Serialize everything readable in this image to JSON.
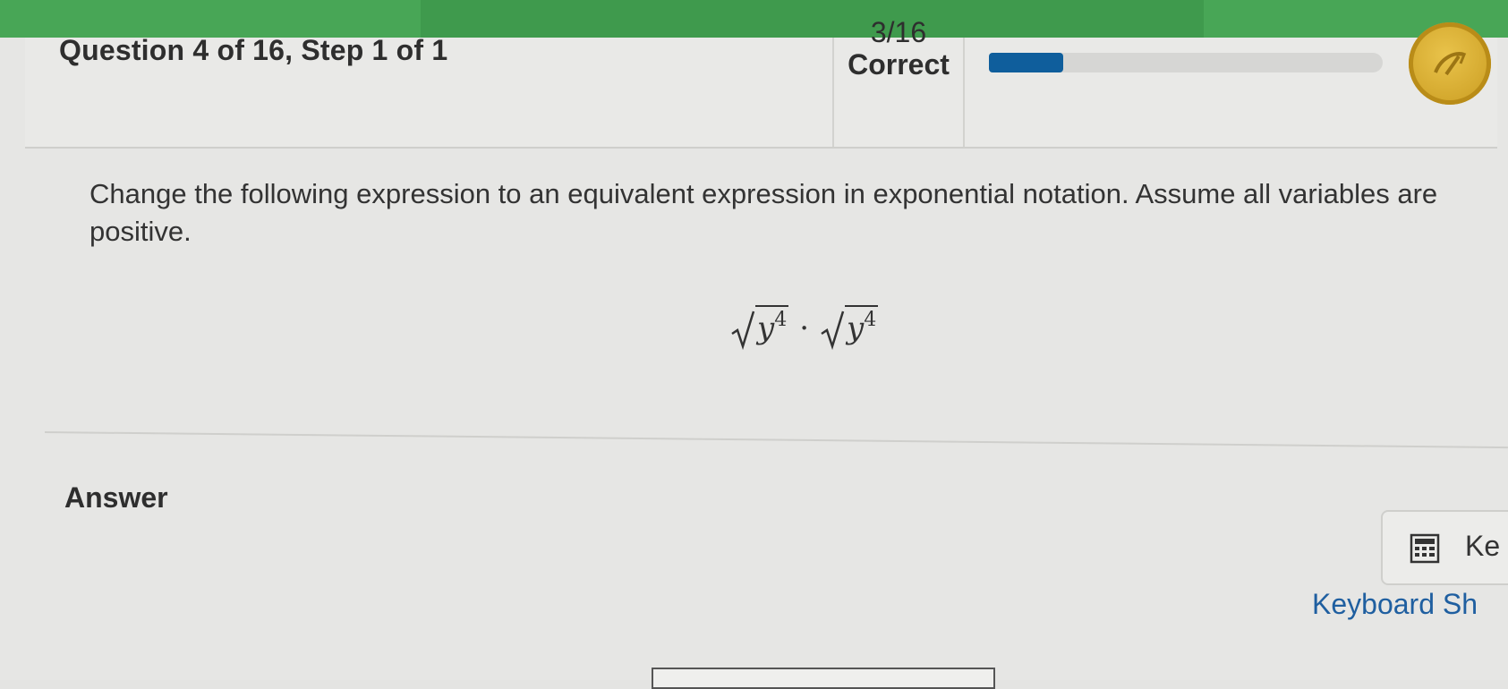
{
  "header": {
    "question_title": "Question 4 of 16, Step 1 of 1",
    "score_fraction": "3/16",
    "score_label": "Correct",
    "progress_fraction": 0.1875
  },
  "question": {
    "prompt": "Change the following expression to an equivalent expression in exponential notation. Assume all variables are positive.",
    "expression": {
      "left_base": "y",
      "left_exponent": "4",
      "operator": "·",
      "right_base": "y",
      "right_exponent": "4"
    }
  },
  "answer": {
    "label": "Answer",
    "keypad_label": "Ke",
    "shortcuts_label": "Keyboard Sh"
  },
  "colors": {
    "top_bar": "#3f9a4d",
    "progress_fill": "#0f5e9c",
    "badge": "#d9ad2f",
    "link": "#1f5fa0"
  },
  "icons": [
    "trophy-badge-icon",
    "calculator-icon",
    "sqrt-icon"
  ]
}
